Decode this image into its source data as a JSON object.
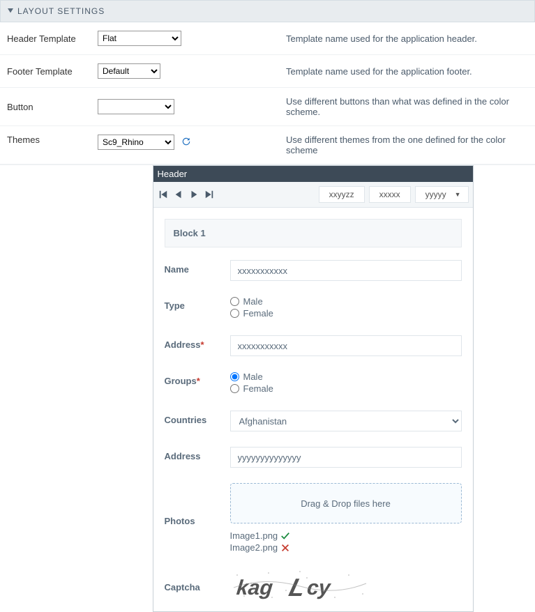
{
  "section_title": "LAYOUT SETTINGS",
  "rows": {
    "header_template": {
      "label": "Header Template",
      "value": "Flat",
      "desc": "Template name used for the application header."
    },
    "footer_template": {
      "label": "Footer Template",
      "value": "Default",
      "desc": "Template name used for the application footer."
    },
    "button": {
      "label": "Button",
      "value": "",
      "desc": "Use different buttons than what was defined in the color scheme."
    },
    "themes": {
      "label": "Themes",
      "value": "Sc9_Rhino",
      "desc": "Use different themes from the one defined for the color scheme"
    }
  },
  "preview": {
    "header": "Header",
    "tabs": {
      "t1": "xxyyzz",
      "t2": "xxxxx",
      "dd": "yyyyy"
    },
    "block_title": "Block 1",
    "fields": {
      "name": {
        "label": "Name",
        "value": "xxxxxxxxxxx"
      },
      "type": {
        "label": "Type",
        "opt1": "Male",
        "opt2": "Female"
      },
      "address_req": {
        "label": "Address",
        "value": "xxxxxxxxxxx"
      },
      "groups": {
        "label": "Groups",
        "opt1": "Male",
        "opt2": "Female"
      },
      "countries": {
        "label": "Countries",
        "value": "Afghanistan"
      },
      "address": {
        "label": "Address",
        "value": "yyyyyyyyyyyyyy"
      },
      "photos": {
        "label": "Photos",
        "drop": "Drag & Drop files here",
        "file1": "Image1.png",
        "file2": "Image2.png"
      },
      "captcha": {
        "label": "Captcha",
        "text": "kagLcy"
      }
    }
  }
}
